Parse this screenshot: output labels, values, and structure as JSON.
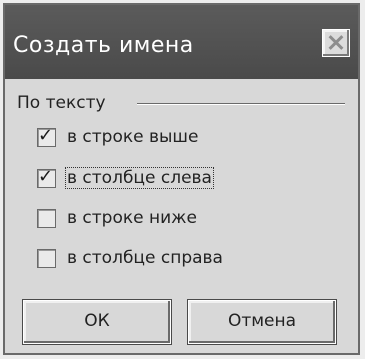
{
  "dialog": {
    "title": "Создать имена"
  },
  "group": {
    "label": "По тексту"
  },
  "options": [
    {
      "label": "в строке выше",
      "checked": true
    },
    {
      "label": "в столбце слева",
      "checked": true
    },
    {
      "label": "в строке ниже",
      "checked": false
    },
    {
      "label": "в столбце справа",
      "checked": false
    }
  ],
  "buttons": {
    "ok_label": "ОК",
    "cancel_label": "Отмена"
  }
}
